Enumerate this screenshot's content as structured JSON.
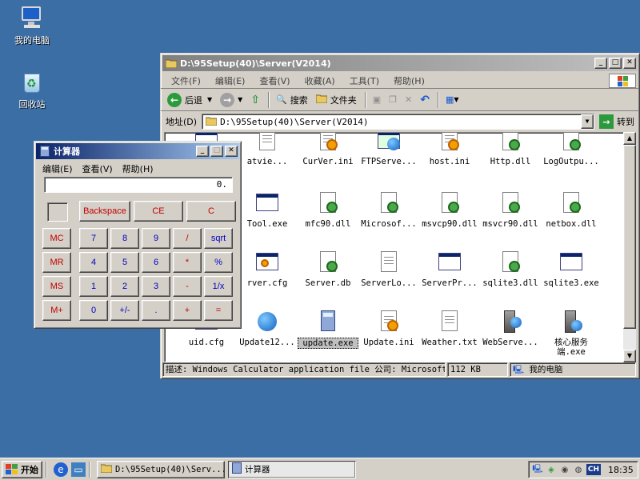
{
  "desktop": {
    "icons": [
      {
        "label": "我的电脑",
        "icon": "my-computer-icon"
      },
      {
        "label": "回收站",
        "icon": "recycle-bin-icon"
      }
    ]
  },
  "explorer": {
    "title": "D:\\95Setup(40)\\Server(V2014)",
    "menu": [
      "文件(F)",
      "编辑(E)",
      "查看(V)",
      "收藏(A)",
      "工具(T)",
      "帮助(H)"
    ],
    "toolbar": {
      "back": "后退",
      "search": "搜索",
      "folders": "文件夹"
    },
    "address_label": "地址(D)",
    "address_value": "D:\\95Setup(40)\\Server(V2014)",
    "go_label": "转到",
    "files": [
      {
        "name": "",
        "icon": "app-icon"
      },
      {
        "name": "atvie...",
        "icon": "doc-icon"
      },
      {
        "name": "CurVer.ini",
        "icon": "config-icon"
      },
      {
        "name": "FTPServe...",
        "icon": "network-icon"
      },
      {
        "name": "host.ini",
        "icon": "config-icon"
      },
      {
        "name": "Http.dll",
        "icon": "dll-icon"
      },
      {
        "name": "LogOutpu...",
        "icon": "dll-icon"
      },
      {
        "name": "Tool.exe",
        "icon": "app-icon"
      },
      {
        "name": "mfc90.dll",
        "icon": "dll-icon"
      },
      {
        "name": "Microsof...",
        "icon": "dll-icon"
      },
      {
        "name": "msvcp90.dll",
        "icon": "dll-icon"
      },
      {
        "name": "msvcr90.dll",
        "icon": "dll-icon"
      },
      {
        "name": "netbox.dll",
        "icon": "dll-icon"
      },
      {
        "name": "rver.cfg",
        "icon": "cfg-icon"
      },
      {
        "name": "Server.db",
        "icon": "dll-icon"
      },
      {
        "name": "ServerLo...",
        "icon": "doc-icon"
      },
      {
        "name": "ServerPr...",
        "icon": "app-icon"
      },
      {
        "name": "sqlite3.dll",
        "icon": "dll-icon"
      },
      {
        "name": "sqlite3.exe",
        "icon": "app-icon"
      },
      {
        "name": "uid.cfg",
        "icon": "cfg-icon"
      },
      {
        "name": "Update12...",
        "icon": "globe-icon"
      },
      {
        "name": "update.exe",
        "icon": "calculator-icon"
      },
      {
        "name": "Update.ini",
        "icon": "config-icon"
      },
      {
        "name": "Weather.txt",
        "icon": "doc-icon"
      },
      {
        "name": "WebServe...",
        "icon": "server-icon"
      },
      {
        "name": "核心服务端.exe",
        "icon": "server-globe-icon"
      }
    ],
    "status": {
      "description": "描述: Windows Calculator application file 公司: Microsoft C",
      "size": "112 KB",
      "zone": "我的电脑"
    }
  },
  "calculator": {
    "title": "计算器",
    "menu": [
      "编辑(E)",
      "查看(V)",
      "帮助(H)"
    ],
    "display": "0.",
    "buttons": {
      "backspace": "Backspace",
      "ce": "CE",
      "c": "C",
      "mc": "MC",
      "mr": "MR",
      "ms": "MS",
      "mplus": "M+",
      "rows": [
        [
          "7",
          "8",
          "9",
          "/",
          "sqrt"
        ],
        [
          "4",
          "5",
          "6",
          "*",
          "%"
        ],
        [
          "1",
          "2",
          "3",
          "-",
          "1/x"
        ],
        [
          "0",
          "+/-",
          ".",
          "+",
          "="
        ]
      ]
    }
  },
  "taskbar": {
    "start": "开始",
    "tasks": [
      "D:\\95Setup(40)\\Serv...",
      "计算器"
    ],
    "tray_lang": "CH",
    "clock": "18:35"
  }
}
